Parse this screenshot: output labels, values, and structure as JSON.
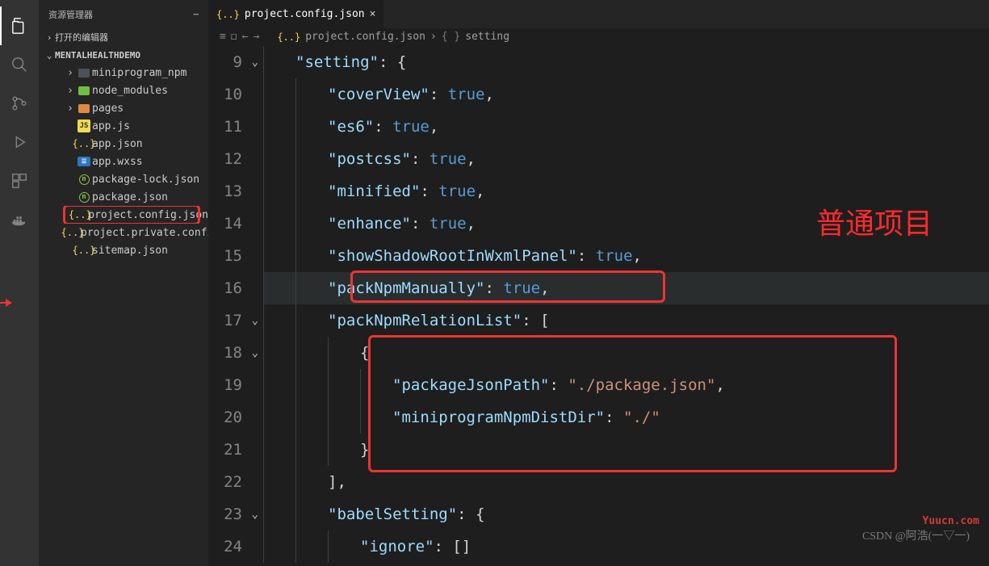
{
  "activityBar": {
    "tooltip": "Explorer"
  },
  "sidebar": {
    "title": "资源管理器",
    "section1": "打开的编辑器",
    "section2": "MENTALHEALTHDEMO",
    "items": [
      {
        "label": "miniprogram_npm",
        "icon": "folder"
      },
      {
        "label": "node_modules",
        "icon": "folder-g"
      },
      {
        "label": "pages",
        "icon": "folder-o"
      },
      {
        "label": "app.js",
        "icon": "js"
      },
      {
        "label": "app.json",
        "icon": "json"
      },
      {
        "label": "app.wxss",
        "icon": "wxss"
      },
      {
        "label": "package-lock.json",
        "icon": "npm"
      },
      {
        "label": "package.json",
        "icon": "npm"
      },
      {
        "label": "project.config.json",
        "icon": "json",
        "selected": true
      },
      {
        "label": "project.private.config.js...",
        "icon": "json"
      },
      {
        "label": "sitemap.json",
        "icon": "json"
      }
    ]
  },
  "tab": {
    "icon": "{..}",
    "label": "project.config.json",
    "close": "×"
  },
  "breadcrumb": {
    "file": "project.config.json",
    "symbol": "setting"
  },
  "annotation": "普通项目",
  "watermark1": "CSDN @阿浩(一▽一)",
  "watermark2": "Yuucn.com",
  "code": {
    "startLine": 9,
    "lines": [
      {
        "n": 9,
        "foldOpen": true,
        "html": "<span class='indent'></span><span class='tok-key'>\"setting\"</span><span class='tok-pun'>: {</span>"
      },
      {
        "n": 10,
        "html": "<span class='indent'></span><span class='indent'></span><span class='tok-key'>\"coverView\"</span><span class='tok-pun'>: </span><span class='tok-lit'>true</span><span class='tok-pun'>,</span>"
      },
      {
        "n": 11,
        "html": "<span class='indent'></span><span class='indent'></span><span class='tok-key'>\"es6\"</span><span class='tok-pun'>: </span><span class='tok-lit'>true</span><span class='tok-pun'>,</span>"
      },
      {
        "n": 12,
        "html": "<span class='indent'></span><span class='indent'></span><span class='tok-key'>\"postcss\"</span><span class='tok-pun'>: </span><span class='tok-lit'>true</span><span class='tok-pun'>,</span>"
      },
      {
        "n": 13,
        "html": "<span class='indent'></span><span class='indent'></span><span class='tok-key'>\"minified\"</span><span class='tok-pun'>: </span><span class='tok-lit'>true</span><span class='tok-pun'>,</span>"
      },
      {
        "n": 14,
        "html": "<span class='indent'></span><span class='indent'></span><span class='tok-key'>\"enhance\"</span><span class='tok-pun'>: </span><span class='tok-lit'>true</span><span class='tok-pun'>,</span>"
      },
      {
        "n": 15,
        "html": "<span class='indent'></span><span class='indent'></span><span class='tok-key'>\"showShadowRootInWxmlPanel\"</span><span class='tok-pun'>: </span><span class='tok-lit'>true</span><span class='tok-pun'>,</span>"
      },
      {
        "n": 16,
        "hl": true,
        "html": "<span class='indent'></span><span class='indent'></span><span class='tok-key'>\"packNpmManually\"</span><span class='tok-pun'>: </span><span class='tok-lit'>true</span><span class='tok-pun'>,</span>"
      },
      {
        "n": 17,
        "foldOpen": true,
        "html": "<span class='indent'></span><span class='indent'></span><span class='tok-key'>\"packNpmRelationList\"</span><span class='tok-pun'>: [</span>"
      },
      {
        "n": 18,
        "foldOpen": true,
        "html": "<span class='indent'></span><span class='indent'></span><span class='indent'></span><span class='tok-pun'>{</span>"
      },
      {
        "n": 19,
        "html": "<span class='indent'></span><span class='indent'></span><span class='indent'></span><span class='indent'></span><span class='tok-key'>\"packageJsonPath\"</span><span class='tok-pun'>: </span><span class='tok-str'>\"./package.json\"</span><span class='tok-pun'>,</span>"
      },
      {
        "n": 20,
        "html": "<span class='indent'></span><span class='indent'></span><span class='indent'></span><span class='indent'></span><span class='tok-key'>\"miniprogramNpmDistDir\"</span><span class='tok-pun'>: </span><span class='tok-str'>\"./\"</span>"
      },
      {
        "n": 21,
        "html": "<span class='indent'></span><span class='indent'></span><span class='indent'></span><span class='tok-pun'>}</span>"
      },
      {
        "n": 22,
        "html": "<span class='indent'></span><span class='indent'></span><span class='tok-pun'>]</span><span class='tok-pun'>,</span>"
      },
      {
        "n": 23,
        "foldOpen": true,
        "html": "<span class='indent'></span><span class='indent'></span><span class='tok-key'>\"babelSetting\"</span><span class='tok-pun'>: {</span>"
      },
      {
        "n": 24,
        "html": "<span class='indent'></span><span class='indent'></span><span class='indent'></span><span class='tok-key'>\"ignore\"</span><span class='tok-pun'>: []</span>"
      }
    ]
  }
}
